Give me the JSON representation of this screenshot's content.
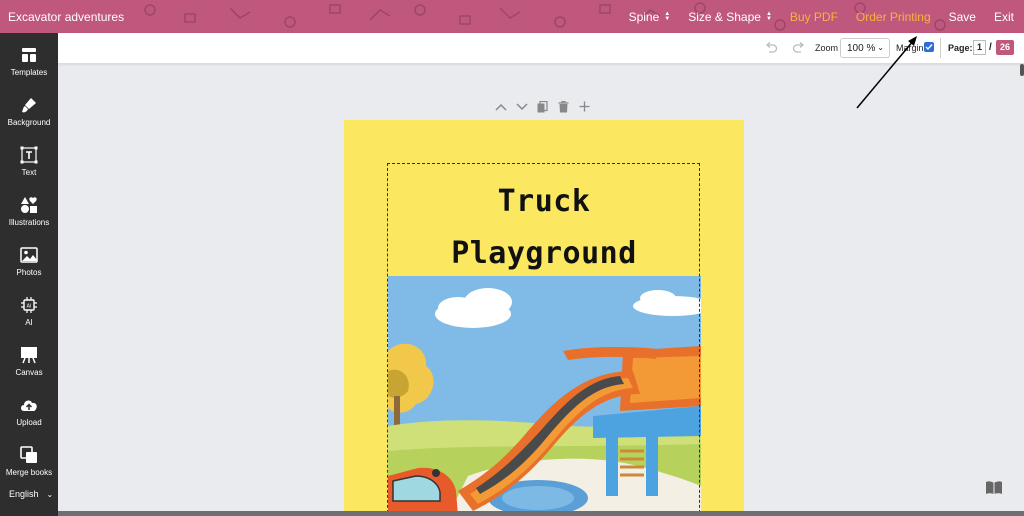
{
  "app": {
    "title": "Excavator adventures"
  },
  "topnav": {
    "spine": "Spine",
    "size_shape": "Size & Shape",
    "buy_pdf": "Buy PDF",
    "order_printing": "Order Printing",
    "save": "Save",
    "exit": "Exit"
  },
  "sidebar": {
    "items": [
      {
        "label": "Templates",
        "icon": "templates-icon"
      },
      {
        "label": "Background",
        "icon": "paint-brush-icon"
      },
      {
        "label": "Text",
        "icon": "text-icon"
      },
      {
        "label": "Illustrations",
        "icon": "shapes-icon"
      },
      {
        "label": "Photos",
        "icon": "image-icon"
      },
      {
        "label": "AI",
        "icon": "ai-chip-icon"
      },
      {
        "label": "Canvas",
        "icon": "easel-icon"
      },
      {
        "label": "Upload",
        "icon": "cloud-upload-icon"
      },
      {
        "label": "Merge books",
        "icon": "merge-icon"
      }
    ],
    "language": "English"
  },
  "toolbar": {
    "zoom_label": "Zoom",
    "zoom_value": "100 %",
    "margin_label": "Margin",
    "margin_checked": true,
    "page_label": "Page:",
    "page_current": "1",
    "page_separator": "/",
    "page_total": "26"
  },
  "book": {
    "title_line1": "Truck",
    "title_line2": "Playground",
    "background_color": "#fbe860"
  },
  "colors": {
    "brand": "#c0577d",
    "accent_orange": "#f6b43c",
    "sidebar": "#2e2e2e"
  }
}
